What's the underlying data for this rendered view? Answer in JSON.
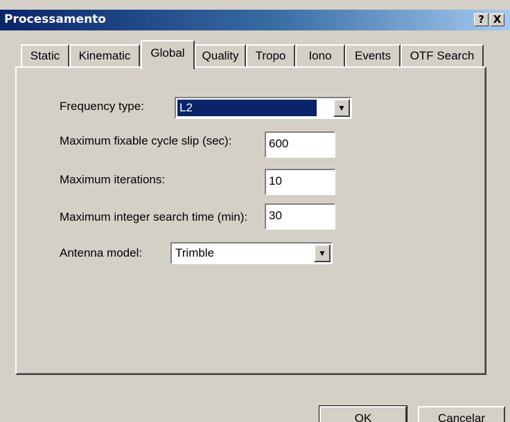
{
  "window": {
    "title": "Processamento",
    "help_button": "?",
    "close_button": "X"
  },
  "tabs": [
    {
      "label": "Static"
    },
    {
      "label": "Kinematic"
    },
    {
      "label": "Global",
      "active": true
    },
    {
      "label": "Quality"
    },
    {
      "label": "Tropo"
    },
    {
      "label": "Iono"
    },
    {
      "label": "Events"
    },
    {
      "label": "OTF Search"
    }
  ],
  "form": {
    "frequency_type": {
      "label": "Frequency type:",
      "value": "L2"
    },
    "max_cycle_slip": {
      "label": "Maximum fixable cycle slip (sec):",
      "value": "600"
    },
    "max_iterations": {
      "label": "Maximum iterations:",
      "value": "10"
    },
    "max_search_time": {
      "label": "Maximum integer search time (min):",
      "value": "30"
    },
    "antenna_model": {
      "label": "Antenna model:",
      "value": "Trimble"
    }
  },
  "buttons": {
    "ok": "OK",
    "cancel": "Cancelar"
  }
}
